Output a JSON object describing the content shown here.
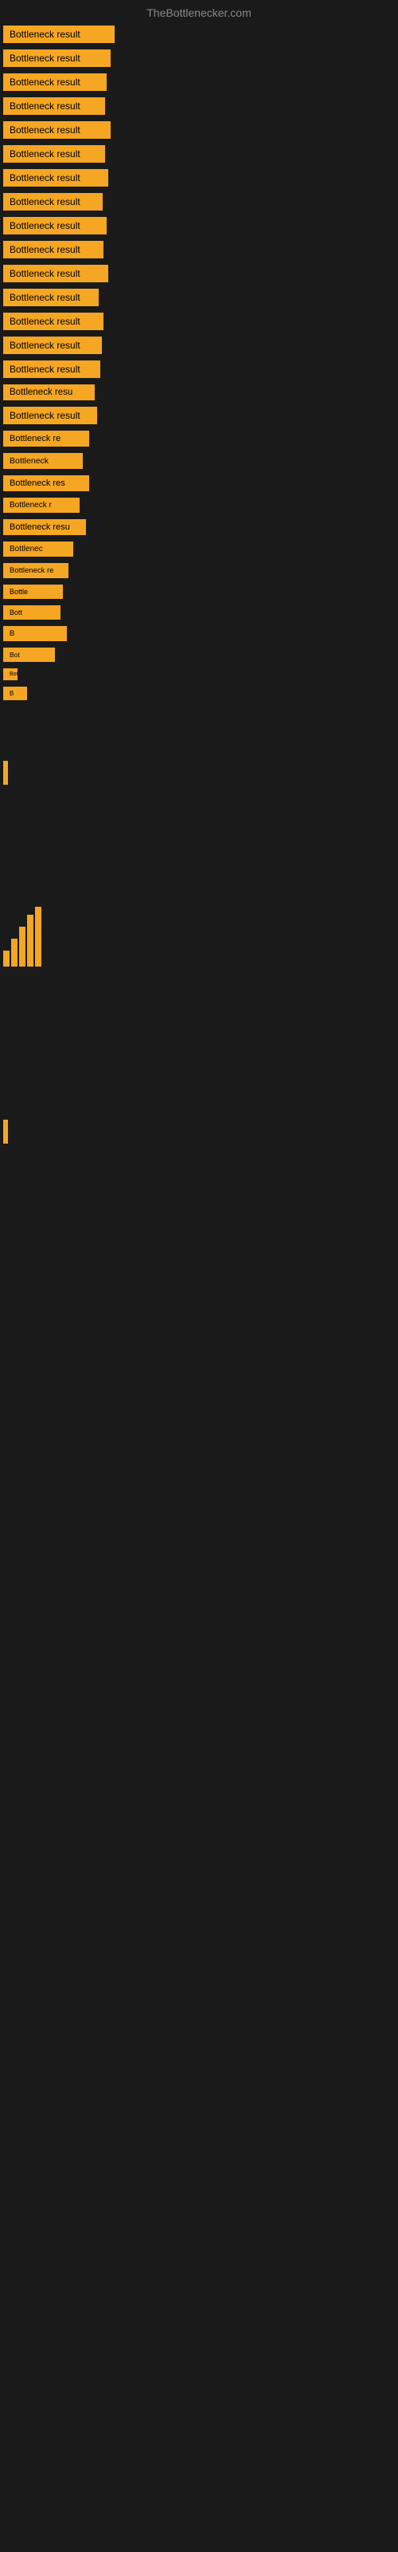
{
  "site": {
    "title": "TheBottlenecker.com"
  },
  "items": [
    {
      "id": 1,
      "label": "Bottleneck result"
    },
    {
      "id": 2,
      "label": "Bottleneck result"
    },
    {
      "id": 3,
      "label": "Bottleneck result"
    },
    {
      "id": 4,
      "label": "Bottleneck result"
    },
    {
      "id": 5,
      "label": "Bottleneck result"
    },
    {
      "id": 6,
      "label": "Bottleneck result"
    },
    {
      "id": 7,
      "label": "Bottleneck result"
    },
    {
      "id": 8,
      "label": "Bottleneck result"
    },
    {
      "id": 9,
      "label": "Bottleneck result"
    },
    {
      "id": 10,
      "label": "Bottleneck result"
    },
    {
      "id": 11,
      "label": "Bottleneck result"
    },
    {
      "id": 12,
      "label": "Bottleneck result"
    },
    {
      "id": 13,
      "label": "Bottleneck result"
    },
    {
      "id": 14,
      "label": "Bottleneck result"
    },
    {
      "id": 15,
      "label": "Bottleneck result"
    },
    {
      "id": 16,
      "label": "Bottleneck resu"
    },
    {
      "id": 17,
      "label": "Bottleneck result"
    },
    {
      "id": 18,
      "label": "Bottleneck re"
    },
    {
      "id": 19,
      "label": "Bottleneck"
    },
    {
      "id": 20,
      "label": "Bottleneck res"
    },
    {
      "id": 21,
      "label": "Bottleneck r"
    },
    {
      "id": 22,
      "label": "Bottleneck resu"
    },
    {
      "id": 23,
      "label": "Bottlenec"
    },
    {
      "id": 24,
      "label": "Bottleneck re"
    },
    {
      "id": 25,
      "label": "Bottle"
    },
    {
      "id": 26,
      "label": "Bott"
    },
    {
      "id": 27,
      "label": "B"
    },
    {
      "id": 28,
      "label": "Bot"
    },
    {
      "id": 29,
      "label": "Bottlen"
    },
    {
      "id": 30,
      "label": "B"
    }
  ]
}
